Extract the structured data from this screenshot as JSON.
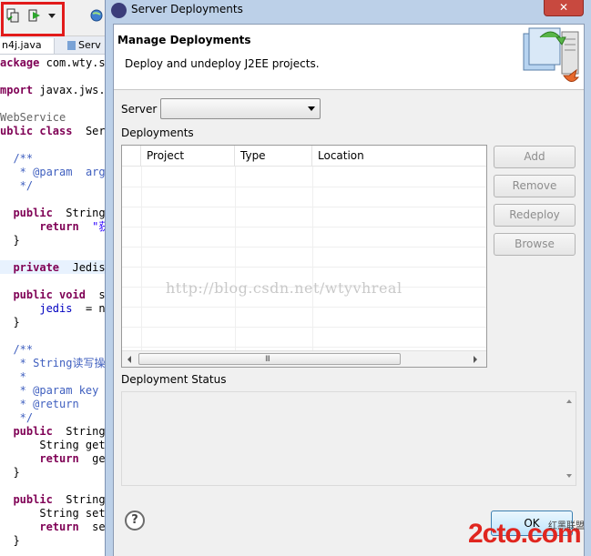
{
  "editor": {
    "tabs": [
      "n4j.java",
      "Serv"
    ],
    "code_lines": [
      {
        "parts": [
          [
            "kw",
            "ackage"
          ],
          [
            "",
            "com.wty.se"
          ]
        ]
      },
      {
        "parts": [
          [
            "kw",
            "mport"
          ],
          [
            "",
            "javax.jws.W"
          ]
        ]
      },
      {
        "parts": [
          [
            "an",
            "WebService"
          ]
        ]
      },
      {
        "parts": [
          [
            "kw",
            "ublic class "
          ],
          [
            "",
            "Servi"
          ]
        ]
      },
      {
        "parts": [
          [
            "cm",
            "  /**"
          ]
        ]
      },
      {
        "parts": [
          [
            "cm",
            "   * @param "
          ],
          [
            "cm",
            "args"
          ]
        ]
      },
      {
        "parts": [
          [
            "cm",
            "   */"
          ]
        ]
      },
      {
        "parts": [
          [
            "kw",
            "  public "
          ],
          [
            "",
            "String"
          ]
        ]
      },
      {
        "parts": [
          [
            "kw",
            "      return "
          ],
          [
            "st",
            "\"获取"
          ]
        ]
      },
      {
        "parts": [
          [
            "",
            "  }"
          ]
        ]
      },
      {
        "parts": [
          [
            "kw",
            "  private "
          ],
          [
            "",
            "Jedis"
          ]
        ]
      },
      {
        "parts": [
          [
            "kw",
            "  public void "
          ],
          [
            "",
            "st"
          ]
        ]
      },
      {
        "parts": [
          [
            "fd",
            "      jedis"
          ],
          [
            "",
            " = ne"
          ]
        ]
      },
      {
        "parts": [
          [
            "",
            "  }"
          ]
        ]
      },
      {
        "parts": [
          [
            "cm",
            "  /**"
          ]
        ]
      },
      {
        "parts": [
          [
            "cm",
            "   * String读写操作"
          ]
        ]
      },
      {
        "parts": [
          [
            "cm",
            "   *"
          ]
        ]
      },
      {
        "parts": [
          [
            "cm",
            "   * @param key"
          ]
        ]
      },
      {
        "parts": [
          [
            "cm",
            "   * @return"
          ]
        ]
      },
      {
        "parts": [
          [
            "cm",
            "   */"
          ]
        ]
      },
      {
        "parts": [
          [
            "kw",
            "  public "
          ],
          [
            "",
            "String"
          ]
        ]
      },
      {
        "parts": [
          [
            "",
            "      String get"
          ]
        ]
      },
      {
        "parts": [
          [
            "kw",
            "      return "
          ],
          [
            "",
            "get"
          ]
        ]
      },
      {
        "parts": [
          [
            "",
            "  }"
          ]
        ]
      },
      {
        "parts": [
          [
            "kw",
            "  public "
          ],
          [
            "",
            "String"
          ]
        ]
      },
      {
        "parts": [
          [
            "",
            "      String set"
          ]
        ]
      },
      {
        "parts": [
          [
            "kw",
            "      return "
          ],
          [
            "",
            "set"
          ]
        ]
      },
      {
        "parts": [
          [
            "",
            "  }"
          ]
        ]
      }
    ]
  },
  "dialog": {
    "window_title": "Server Deployments",
    "close_label": "✕",
    "header_title": "Manage Deployments",
    "header_desc": "Deploy and undeploy J2EE projects.",
    "server_label": "Server",
    "server_value": "",
    "deployments_label": "Deployments",
    "columns": [
      "Project",
      "Type",
      "Location"
    ],
    "scroll_grip": "III",
    "buttons": {
      "add": "Add",
      "remove": "Remove",
      "redeploy": "Redeploy",
      "browse": "Browse"
    },
    "status_label": "Deployment Status",
    "help_label": "?",
    "ok_label": "OK"
  },
  "watermark_text": "http://blog.csdn.net/wtyvhreal",
  "logo": {
    "main": "2cto.com",
    "sub": "红黑联盟"
  }
}
